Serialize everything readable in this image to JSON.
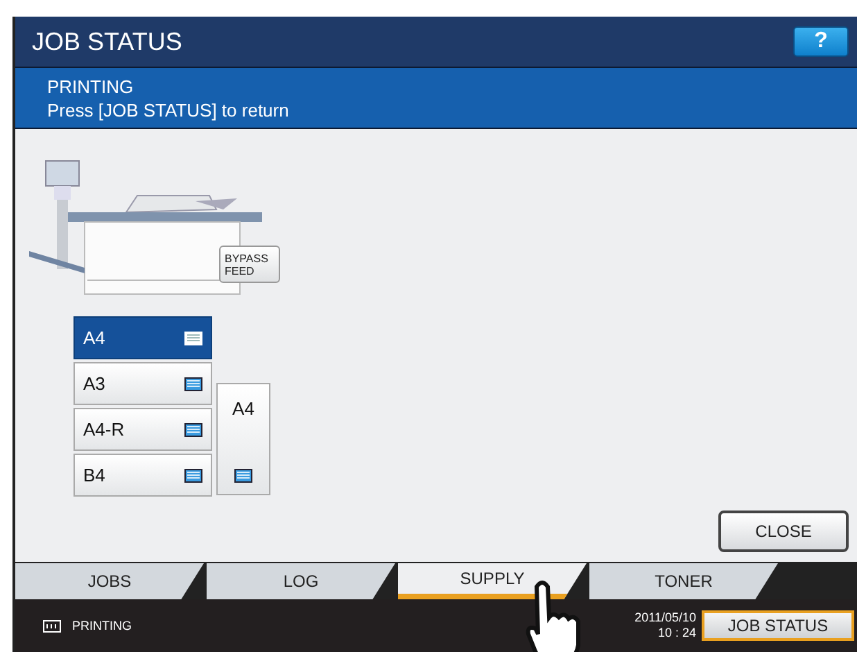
{
  "window": {
    "title": "JOB STATUS",
    "help_button": "?"
  },
  "message": {
    "status": "PRINTING",
    "hint": "Press [JOB STATUS] to return"
  },
  "bypass_feed": {
    "lines": [
      "BYPASS",
      "FEED"
    ]
  },
  "trays": [
    {
      "label": "A4",
      "selected": true,
      "kind": "drawer"
    },
    {
      "label": "A3",
      "selected": false,
      "kind": "drawer"
    },
    {
      "label": "A4-R",
      "selected": false,
      "kind": "drawer"
    },
    {
      "label": "B4",
      "selected": false,
      "kind": "drawer"
    },
    {
      "label": "A4",
      "selected": false,
      "kind": "side"
    }
  ],
  "close_button": "CLOSE",
  "tabs": [
    {
      "label": "JOBS",
      "selected": false
    },
    {
      "label": "LOG",
      "selected": false
    },
    {
      "label": "SUPPLY",
      "selected": true
    },
    {
      "label": "TONER",
      "selected": false
    }
  ],
  "status_bar": {
    "status": "PRINTING",
    "date": "2011/05/10",
    "time": "10 : 24",
    "button": "JOB STATUS"
  }
}
